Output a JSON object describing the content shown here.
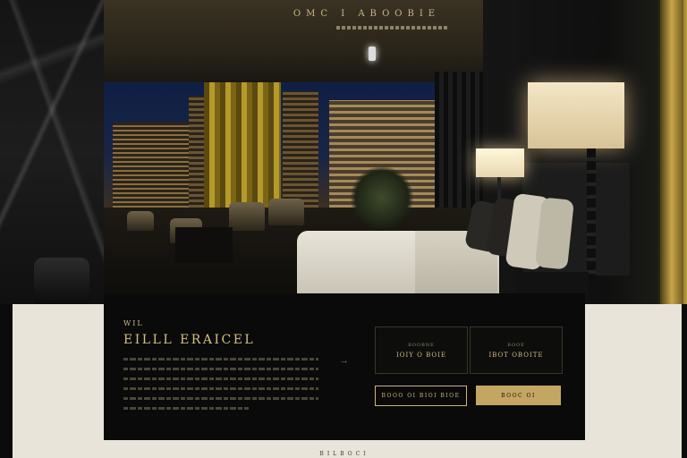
{
  "header": {
    "brand": "OMC I ABOOBIE"
  },
  "card": {
    "eyebrow": "WIL",
    "headline": "EILLL ERAICEL",
    "arrow": "⇢",
    "options": [
      {
        "small": "BOOBNE",
        "title": "IOIY O BOIE"
      },
      {
        "small": "BOOE",
        "title": "IBOT OBOITE"
      }
    ],
    "primary_button": "BOOO OI BIOI BIOE",
    "secondary_button": "BOOC OI"
  },
  "footer": {
    "text": "BILBOCI"
  },
  "colors": {
    "accent_gold": "#c3a662",
    "panel_black": "#0a0a0a",
    "page_cream": "#e8e4d9"
  }
}
